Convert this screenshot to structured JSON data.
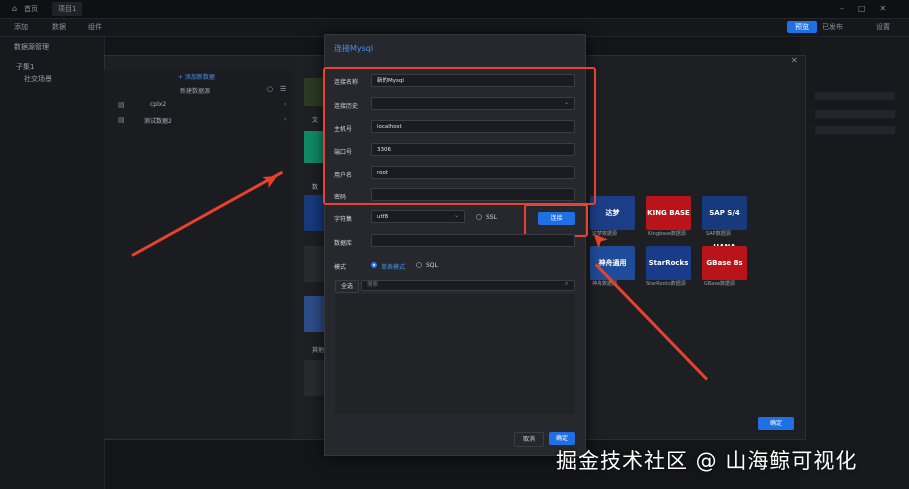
{
  "topbar": {
    "tabs": [
      "首页",
      "项目1"
    ]
  },
  "toolbar": {
    "items": [
      "添加",
      "数据",
      "组件"
    ],
    "run_label": "预览",
    "publish_label": "已发布",
    "settings_label": "设置"
  },
  "left_panel": {
    "title": "数据源管理",
    "items": [
      "子集1",
      "社交场景"
    ]
  },
  "bg_modal": {
    "add_label": "+ 添加新数据",
    "section_label": "新建数据源",
    "items": [
      "cplx2",
      "测试数据2"
    ],
    "sections": [
      "文",
      "数",
      "其他"
    ],
    "tiles": [
      {
        "text": "SAP S/4 HANA",
        "caption": "SAP数据源",
        "color": "#163a7c"
      },
      {
        "text": "KING BASE",
        "caption": "Kingbase数据源",
        "color": "#b8141a"
      },
      {
        "text": "达梦",
        "caption": "达梦数据源",
        "color": "#1c3e87"
      },
      {
        "text": "神舟通用",
        "caption": "神舟数据源",
        "color": "#1f4c9a"
      },
      {
        "text": "StarRocks",
        "caption": "StarRocks数据源",
        "color": "#1a3a8a"
      },
      {
        "text": "GBase 8s",
        "caption": "GBase数据源",
        "color": "#b8141a"
      }
    ],
    "confirm_label": "确定"
  },
  "dialog": {
    "title": "连接Mysql",
    "fields": [
      {
        "label": "连接名称",
        "value": "新的Mysql"
      },
      {
        "label": "连接历史",
        "value": ""
      },
      {
        "label": "主机号",
        "value": "localhost"
      },
      {
        "label": "端口号",
        "value": "3306"
      },
      {
        "label": "用户名",
        "value": "root"
      },
      {
        "label": "密码",
        "value": ""
      }
    ],
    "charset_label": "字符集",
    "charset_value": "utf8",
    "ssl_label": "SSL",
    "connect_label": "连接",
    "database_label": "数据库",
    "mode_label": "模式",
    "mode_options": [
      "单表模式",
      "SQL"
    ],
    "all_label": "全选",
    "search_placeholder": "搜索",
    "cancel_label": "取消",
    "ok_label": "确定"
  },
  "watermark": "掘金技术社区 @ 山海鲸可视化",
  "colors": {
    "accent": "#1f6fe5",
    "highlight": "#e8412e"
  }
}
